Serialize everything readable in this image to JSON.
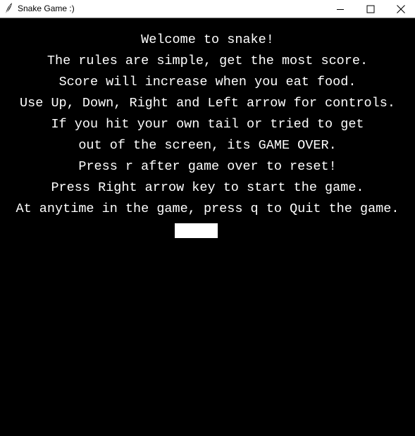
{
  "window": {
    "title": "Snake Game :)",
    "icon": "feather-icon",
    "controls": [
      "minimize-icon",
      "maximize-icon",
      "close-icon"
    ]
  },
  "game": {
    "background_color": "#000000",
    "text_color": "#ffffff",
    "welcome_lines": [
      "Welcome to snake!",
      "The rules are simple, get the most score.",
      "Score will increase when you eat food.",
      "Use Up, Down, Right and Left arrow for controls.",
      "If you hit your own tail or tried to get",
      "out of the screen, its GAME OVER.",
      "Press r after game over to reset!",
      "Press Right arrow key to start the game.",
      "At anytime in the game, press q to Quit the game."
    ],
    "snake": {
      "color": "#ffffff",
      "segments": 3
    }
  }
}
